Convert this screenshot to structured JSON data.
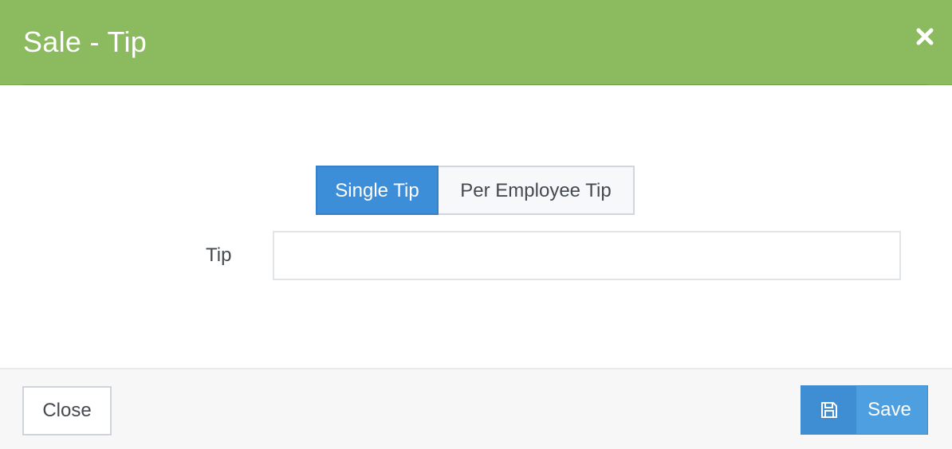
{
  "modal": {
    "title": "Sale - Tip"
  },
  "tip_mode": {
    "options": [
      {
        "label": "Single Tip",
        "selected": true
      },
      {
        "label": "Per Employee Tip",
        "selected": false
      }
    ]
  },
  "tip_field": {
    "label": "Tip",
    "value": "",
    "placeholder": ""
  },
  "footer": {
    "close_label": "Close",
    "save_label": "Save"
  },
  "icons": {
    "close": "close-icon",
    "save": "floppy-disk-icon"
  },
  "colors": {
    "header": "#8cbb5f",
    "accent": "#3d8ed9",
    "save_button": "#4d9fe0"
  }
}
